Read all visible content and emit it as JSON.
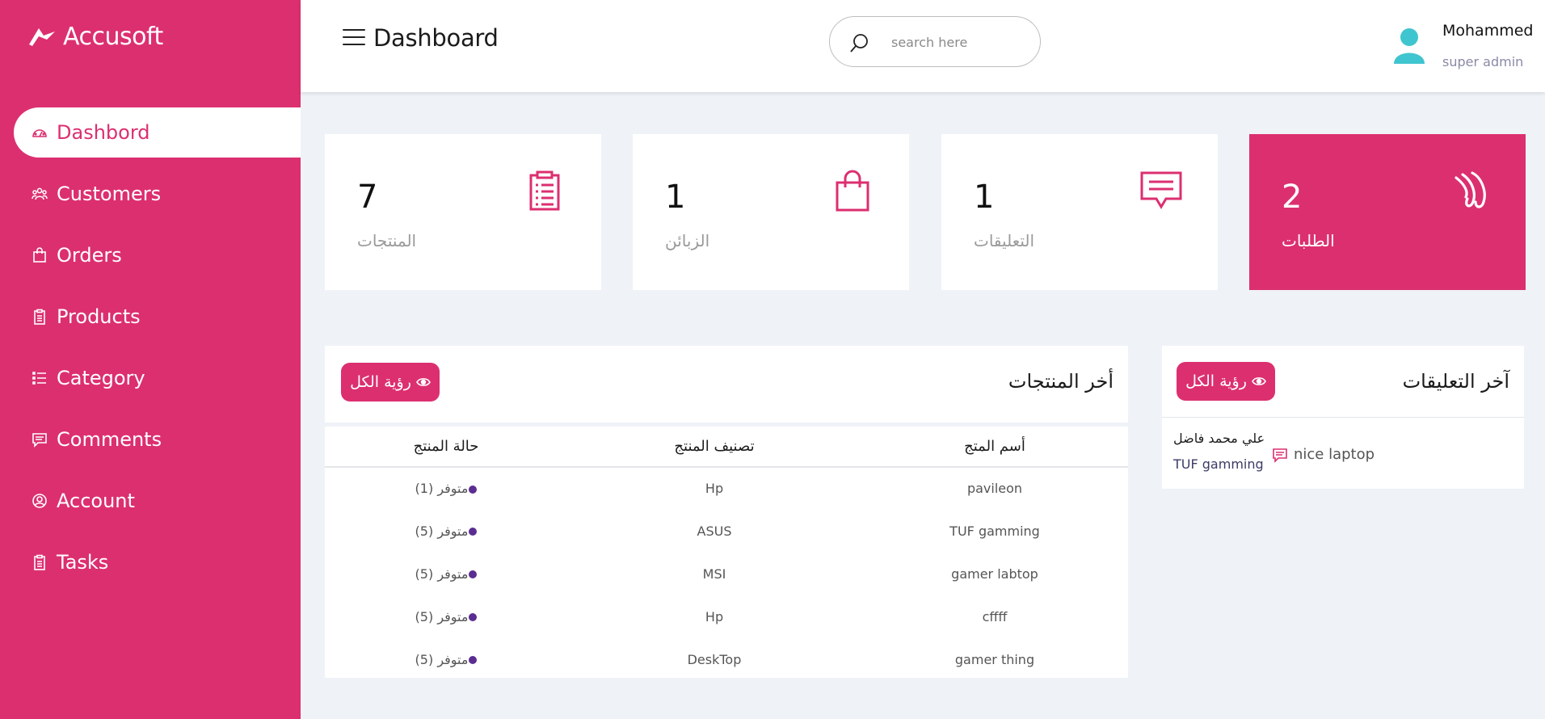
{
  "brand": {
    "name": "Accusoft"
  },
  "sidebar": {
    "items": [
      {
        "label": "Dashbord",
        "icon": "dashboard-gauge-icon",
        "active": true
      },
      {
        "label": "Customers",
        "icon": "users-icon"
      },
      {
        "label": "Orders",
        "icon": "shopping-bag-icon"
      },
      {
        "label": "Products",
        "icon": "clipboard-icon"
      },
      {
        "label": "Category",
        "icon": "list-icon"
      },
      {
        "label": "Comments",
        "icon": "comment-icon"
      },
      {
        "label": "Account",
        "icon": "user-circle-icon"
      },
      {
        "label": "Tasks",
        "icon": "clipboard-icon"
      }
    ]
  },
  "header": {
    "title": "Dashboard",
    "search_placeholder": "search here",
    "user": {
      "name": "Mohammed",
      "role": "super admin"
    }
  },
  "stats": [
    {
      "value": "7",
      "label": "المنتجات",
      "icon": "clipboard-list-icon"
    },
    {
      "value": "1",
      "label": "الزبائن",
      "icon": "shopping-bag-icon"
    },
    {
      "value": "1",
      "label": "التعليقات",
      "icon": "comment-icon"
    },
    {
      "value": "2",
      "label": "الطلبات",
      "icon": "wave-icon"
    }
  ],
  "products_panel": {
    "title": "أخر المنتجات",
    "view_all": "رؤية الكل",
    "columns": [
      "حالة المنتج",
      "تصنيف المنتج",
      "أسم المتج"
    ],
    "rows": [
      {
        "status": "متوفر (1)",
        "category": "Hp",
        "name": "pavileon"
      },
      {
        "status": "متوفر (5)",
        "category": "ASUS",
        "name": "TUF gamming"
      },
      {
        "status": "متوفر (5)",
        "category": "MSI",
        "name": "gamer labtop"
      },
      {
        "status": "متوفر (5)",
        "category": "Hp",
        "name": "cffff"
      },
      {
        "status": "متوفر (5)",
        "category": "DeskTop",
        "name": "gamer thing"
      }
    ]
  },
  "comments_panel": {
    "title": "آخر التعليقات",
    "view_all": "رؤية الكل",
    "items": [
      {
        "author": "علي محمد فاضل",
        "product": "TUF gamming",
        "text": "nice laptop"
      }
    ]
  },
  "colors": {
    "accent": "#dc2f70",
    "background": "#eff2f7",
    "avatar": "#3fc5cf",
    "status_dot": "#5b2d91"
  }
}
